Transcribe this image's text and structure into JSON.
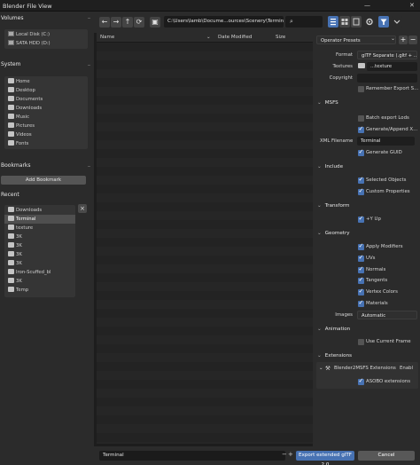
{
  "window": {
    "title": "Blender File View",
    "minimize": "—",
    "close": "✕"
  },
  "sidebar": {
    "volumes_title": "Volumes",
    "volumes": [
      {
        "label": "Local Disk (C:)",
        "icon": "disk-icon"
      },
      {
        "label": "SATA HDD (D:)",
        "icon": "disk-icon"
      }
    ],
    "system_title": "System",
    "system": [
      {
        "label": "Home",
        "icon": "home-icon"
      },
      {
        "label": "Desktop",
        "icon": "desktop-icon"
      },
      {
        "label": "Documents",
        "icon": "documents-icon"
      },
      {
        "label": "Downloads",
        "icon": "downloads-icon"
      },
      {
        "label": "Music",
        "icon": "music-icon"
      },
      {
        "label": "Pictures",
        "icon": "pictures-icon"
      },
      {
        "label": "Videos",
        "icon": "videos-icon"
      },
      {
        "label": "Fonts",
        "icon": "fonts-icon"
      }
    ],
    "bookmarks_title": "Bookmarks",
    "add_bookmark": "Add Bookmark",
    "recent_title": "Recent",
    "recent": [
      {
        "label": "Downloads",
        "selected": false
      },
      {
        "label": "Terminal",
        "selected": true
      },
      {
        "label": "texture",
        "selected": false
      },
      {
        "label": "3K",
        "selected": false
      },
      {
        "label": "3K",
        "selected": false
      },
      {
        "label": "3K",
        "selected": false
      },
      {
        "label": "3K",
        "selected": false
      },
      {
        "label": "Iron-Scuffed_bl",
        "selected": false
      },
      {
        "label": "3K",
        "selected": false
      },
      {
        "label": "Temp",
        "selected": false
      }
    ]
  },
  "toolbar": {
    "back": "←",
    "forward": "→",
    "parent": "↑",
    "refresh": "⟳",
    "new_folder": "▣",
    "path": "C:\\Users\\lamb\\Docume...ources\\Scenery\\Terminal\\",
    "search_icon": "⌕"
  },
  "filelist": {
    "col_name": "Name",
    "col_date": "Date Modified",
    "col_size": "Size"
  },
  "operator_presets": {
    "label": "Operator Presets",
    "add": "+",
    "remove": "−"
  },
  "format": {
    "label": "Format",
    "value": "glTF Separate (.gltf + ..."
  },
  "textures": {
    "label": "Textures",
    "value": "...texture"
  },
  "copyright": {
    "label": "Copyright",
    "value": ""
  },
  "remember_export": {
    "label": "Remember Export S...",
    "checked": false
  },
  "msfs": {
    "title": "MSFS",
    "batch_export": {
      "label": "Batch export Lods",
      "checked": false
    },
    "generate_append": {
      "label": "Generate/Append X...",
      "checked": true
    },
    "xml_filename": {
      "label": "XML Filename",
      "value": "Terminal"
    },
    "generate_guid": {
      "label": "Generate GUID",
      "checked": true
    }
  },
  "include": {
    "title": "Include",
    "selected_objects": {
      "label": "Selected Objects",
      "checked": true
    },
    "custom_properties": {
      "label": "Custom Properties",
      "checked": true
    }
  },
  "transform": {
    "title": "Transform",
    "y_up": {
      "label": "+Y Up",
      "checked": true
    }
  },
  "geometry": {
    "title": "Geometry",
    "apply_modifiers": {
      "label": "Apply Modifiers",
      "checked": true
    },
    "uvs": {
      "label": "UVs",
      "checked": true
    },
    "normals": {
      "label": "Normals",
      "checked": true
    },
    "tangents": {
      "label": "Tangents",
      "checked": true
    },
    "vertex_colors": {
      "label": "Vertex Colors",
      "checked": true
    },
    "materials": {
      "label": "Materials",
      "checked": true
    },
    "images_label": "Images",
    "images_value": "Automatic"
  },
  "animation": {
    "title": "Animation",
    "use_current_frame": {
      "label": "Use Current Frame",
      "checked": false
    }
  },
  "extensions": {
    "title": "Extensions",
    "blender2msfs": "Blender2MSFS Extensions",
    "enable_label": "Enabl",
    "asobo": {
      "label": "ASOBO extensions",
      "checked": true
    }
  },
  "bottom": {
    "filename": "Terminal",
    "export_button": "Export extended glTF 2.0",
    "cancel_button": "Cancel"
  },
  "colors": {
    "accent": "#4772b3",
    "bg": "#2b2b2b"
  }
}
